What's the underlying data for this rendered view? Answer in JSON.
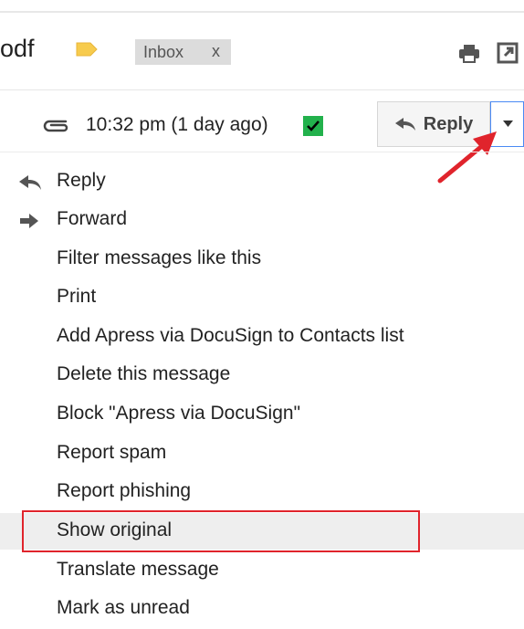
{
  "header": {
    "subject_fragment": "odf",
    "label_chip": {
      "text": "Inbox",
      "remove_glyph": "x"
    },
    "icons": [
      "tag-icon",
      "print-icon",
      "popout-icon"
    ]
  },
  "message": {
    "timestamp": "10:32 pm (1 day ago)",
    "attachment_icon": "paperclip-icon",
    "check_icon": "checkbox-checked-icon",
    "reply_button_label": "Reply",
    "dropdown_icon": "caret-down-icon"
  },
  "menu": {
    "items": [
      {
        "label": "Reply",
        "icon": "reply-arrow-icon"
      },
      {
        "label": "Forward",
        "icon": "forward-arrow-icon"
      },
      {
        "label": "Filter messages like this"
      },
      {
        "label": "Print"
      },
      {
        "label": "Add Apress via DocuSign to Contacts list"
      },
      {
        "label": "Delete this message"
      },
      {
        "label": "Block \"Apress via DocuSign\""
      },
      {
        "label": "Report spam"
      },
      {
        "label": "Report phishing"
      },
      {
        "label": "Show original",
        "highlighted": true
      },
      {
        "label": "Translate message"
      },
      {
        "label": "Mark as unread"
      }
    ]
  },
  "colors": {
    "annotation_red": "#e0242c",
    "check_green": "#22b14c",
    "tag_yellow": "#f7cb4d",
    "dropdown_border_blue": "#4a8af4"
  }
}
